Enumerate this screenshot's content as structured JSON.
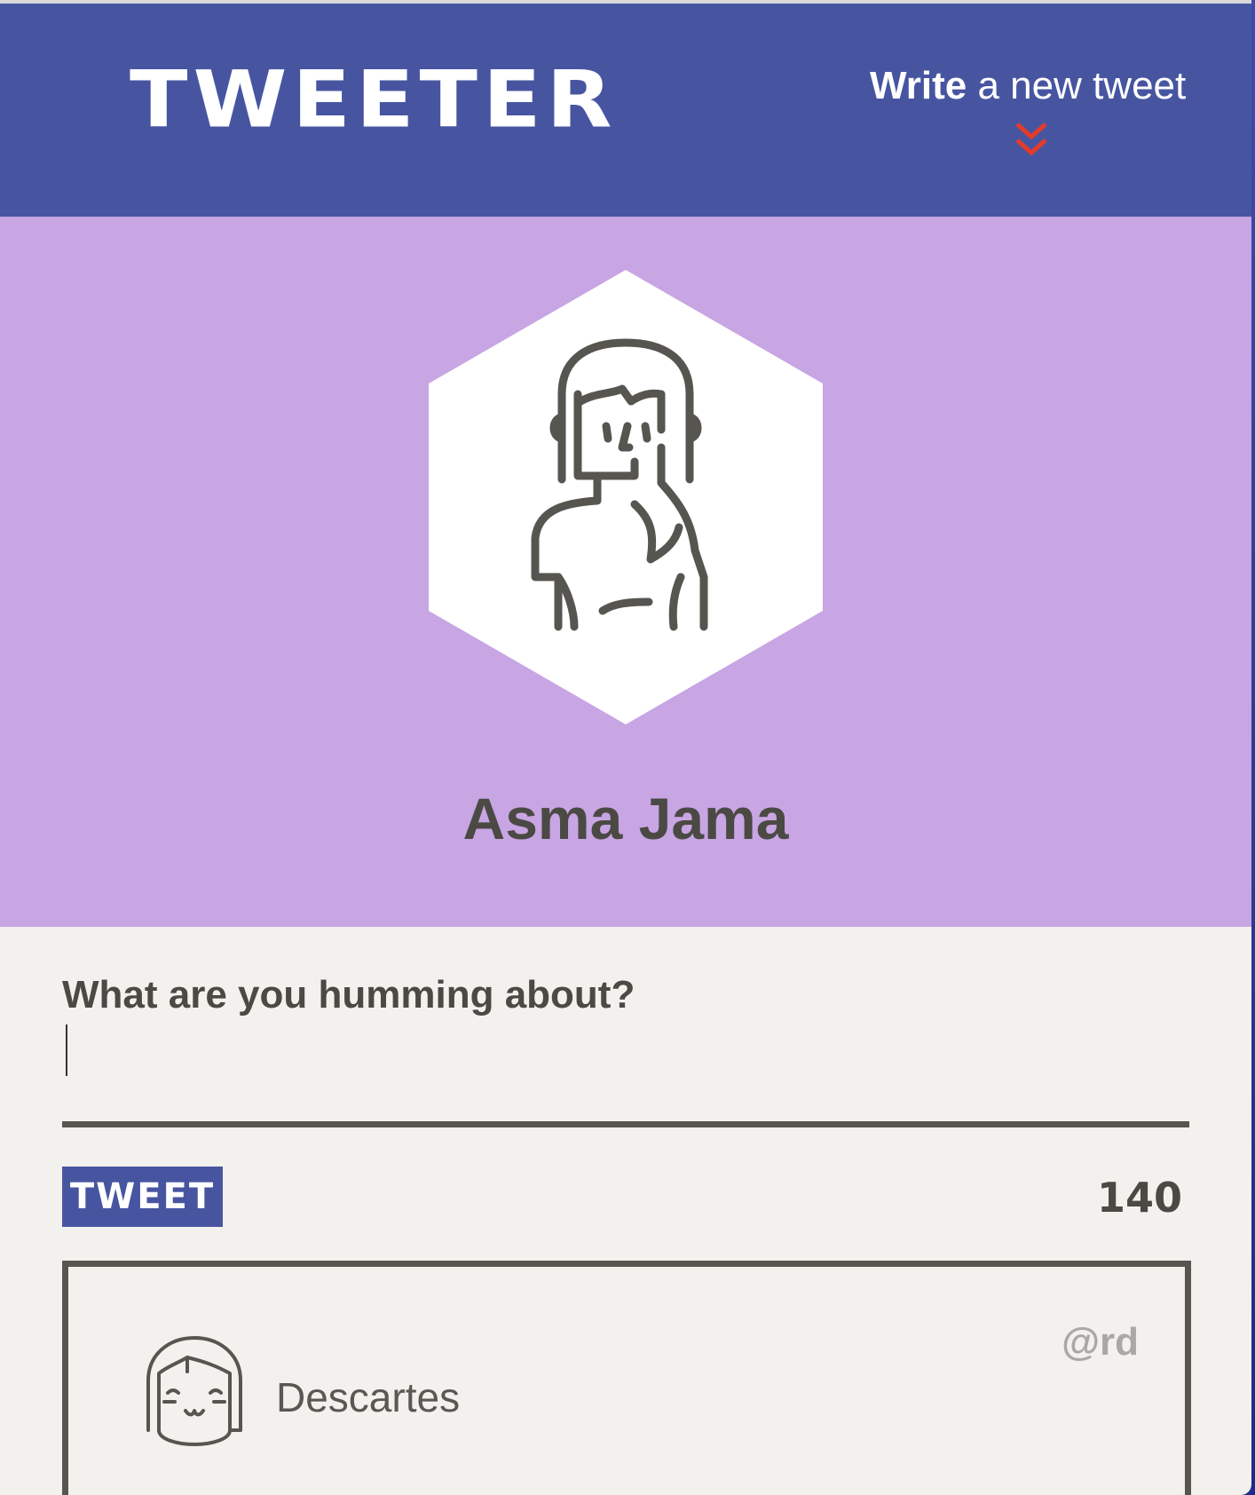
{
  "header": {
    "brand": "TWEETER",
    "compose_toggle_bold": "Write",
    "compose_toggle_rest": " a new tweet",
    "toggle_icon": "double-chevron-down-icon",
    "accent_color": "#e53b2c"
  },
  "profile": {
    "name": "Asma Jama",
    "avatar_icon": "woman-avatar-icon",
    "background_color": "#c8a5e3"
  },
  "composer": {
    "label": "What are you humming about?",
    "value": "",
    "button_label": "TWEET",
    "counter": "140"
  },
  "tweets": [
    {
      "author": "Descartes",
      "handle": "@rd",
      "avatar_icon": "smiling-girl-avatar-icon"
    }
  ],
  "colors": {
    "nav": "#4755a1",
    "text_dark": "#4b4944",
    "page_bg": "#f2f1ed"
  }
}
